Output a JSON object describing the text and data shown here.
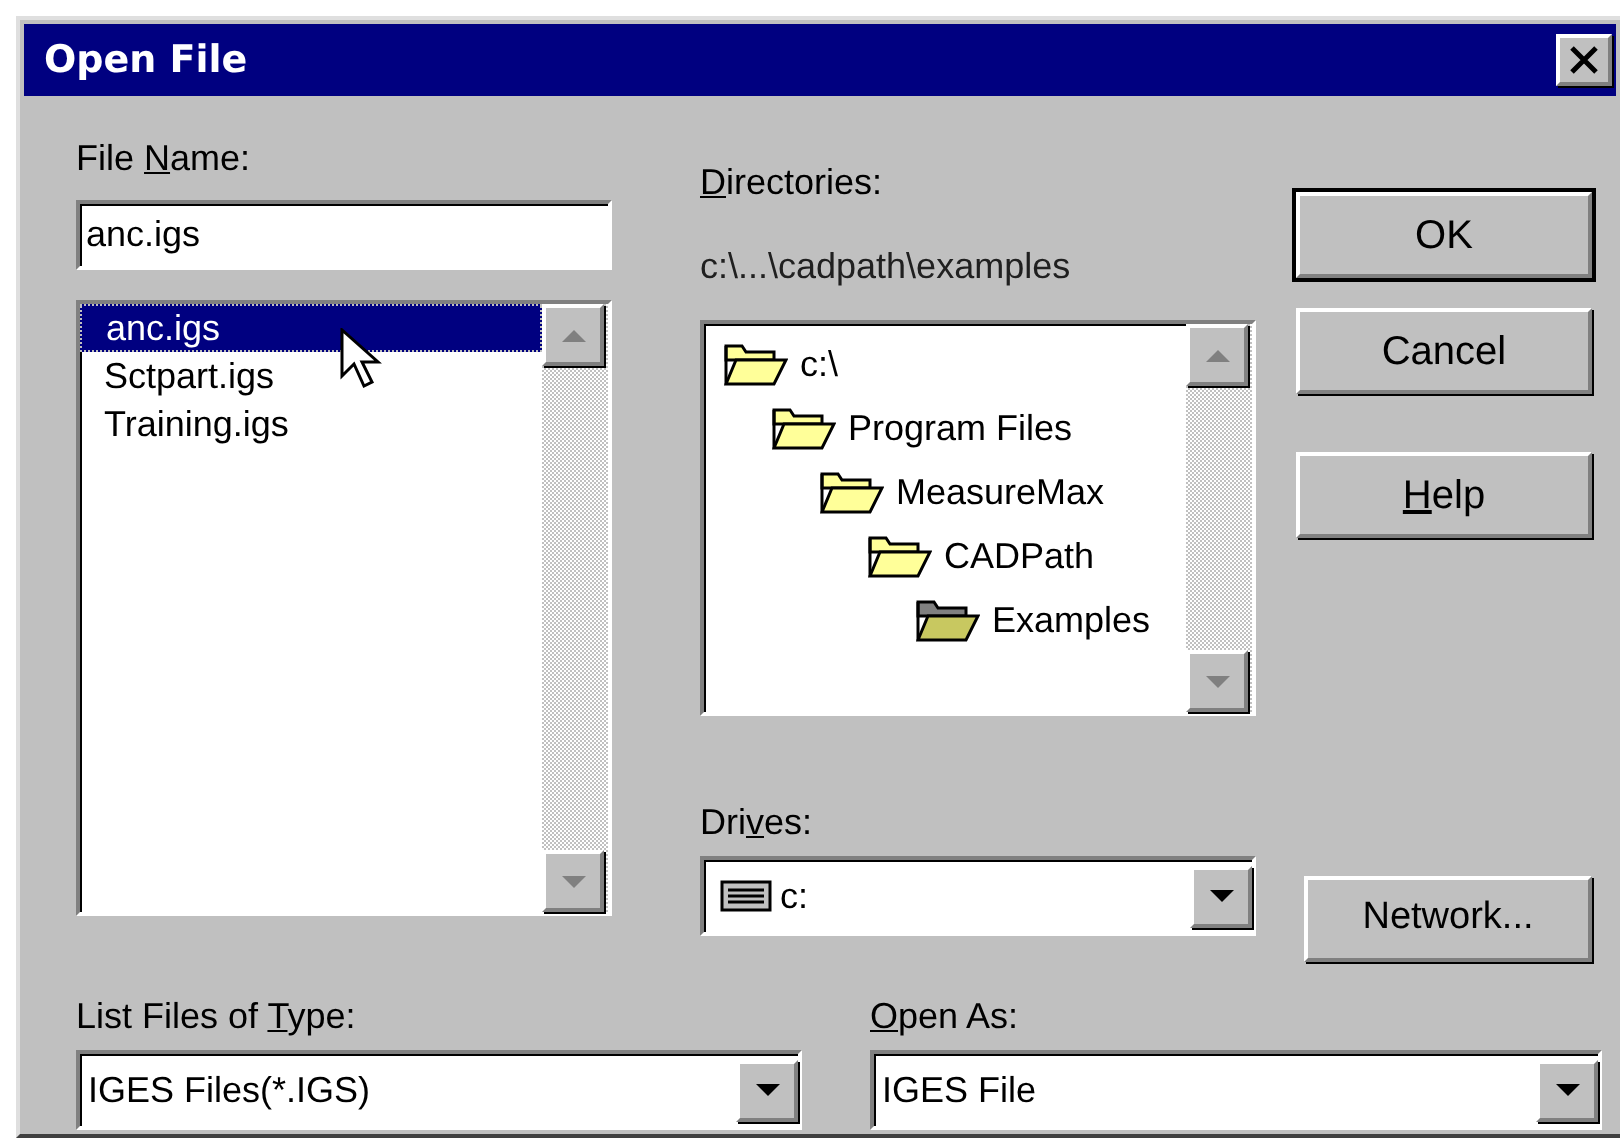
{
  "window": {
    "title": "Open File"
  },
  "file_name": {
    "label": {
      "pre": "File ",
      "key": "N",
      "post": "ame:"
    },
    "value": "anc.igs"
  },
  "files": [
    {
      "name": "anc.igs",
      "selected": true
    },
    {
      "name": "Sctpart.igs",
      "selected": false
    },
    {
      "name": "Training.igs",
      "selected": false
    }
  ],
  "directories": {
    "label": {
      "key": "D",
      "post": "irectories:"
    },
    "path": "c:\\...\\cadpath\\examples",
    "tree": [
      {
        "name": "c:\\",
        "selected": false,
        "children": [
          {
            "name": "Program Files",
            "selected": false,
            "children": [
              {
                "name": "MeasureMax",
                "selected": false,
                "children": [
                  {
                    "name": "CADPath",
                    "selected": false,
                    "children": [
                      {
                        "name": "Examples",
                        "selected": true
                      }
                    ]
                  }
                ]
              }
            ]
          }
        ]
      }
    ]
  },
  "buttons": [
    {
      "label": {
        "pre": "OK"
      },
      "default": true
    },
    {
      "label": {
        "pre": "Cancel"
      },
      "default": false
    },
    {
      "label": {
        "key": "H",
        "post": "elp"
      },
      "default": false
    }
  ],
  "drives": {
    "label": {
      "pre": "Dri",
      "key": "v",
      "post": "es:"
    },
    "value": "c:"
  },
  "network_button": {
    "label": {
      "pre": "Network..."
    }
  },
  "file_type": {
    "label": {
      "pre": "List Files of ",
      "key": "T",
      "post": "ype:"
    },
    "value": "IGES Files(*.IGS)"
  },
  "open_as": {
    "label": {
      "key": "O",
      "post": "pen As:"
    },
    "value": "IGES File"
  }
}
